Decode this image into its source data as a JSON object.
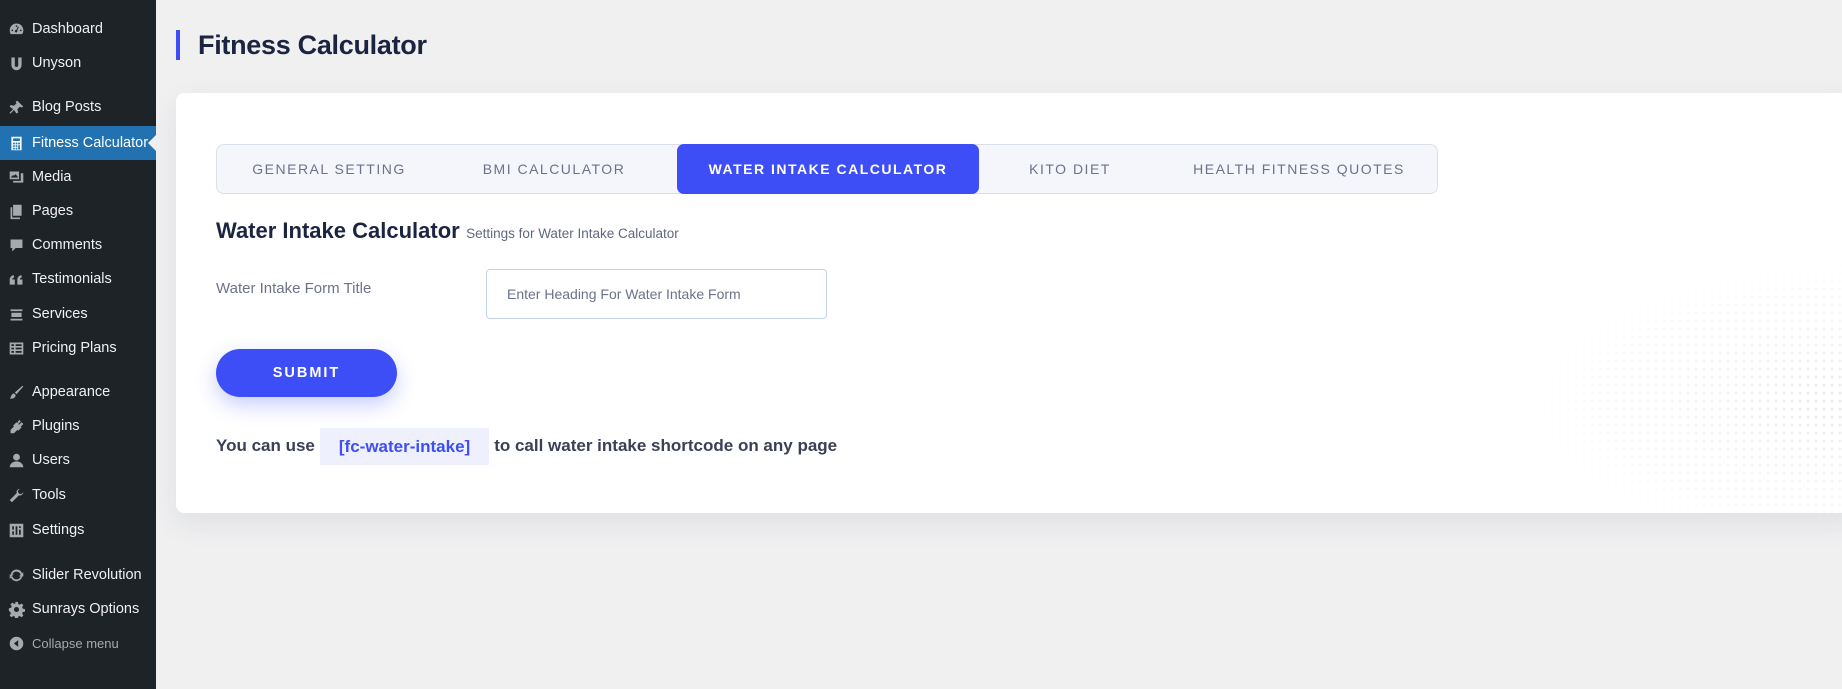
{
  "sidebar": {
    "items": [
      {
        "label": "Dashboard",
        "icon": "dashboard-icon"
      },
      {
        "label": "Unyson",
        "icon": "unyson-icon"
      },
      {
        "label": "Blog Posts",
        "icon": "pin-icon"
      },
      {
        "label": "Fitness Calculator",
        "icon": "calculator-icon",
        "active": true
      },
      {
        "label": "Media",
        "icon": "media-icon"
      },
      {
        "label": "Pages",
        "icon": "pages-icon"
      },
      {
        "label": "Comments",
        "icon": "comments-icon"
      },
      {
        "label": "Testimonials",
        "icon": "quote-icon"
      },
      {
        "label": "Services",
        "icon": "services-icon"
      },
      {
        "label": "Pricing Plans",
        "icon": "table-icon"
      },
      {
        "label": "Appearance",
        "icon": "brush-icon"
      },
      {
        "label": "Plugins",
        "icon": "plugin-icon"
      },
      {
        "label": "Users",
        "icon": "user-icon"
      },
      {
        "label": "Tools",
        "icon": "wrench-icon"
      },
      {
        "label": "Settings",
        "icon": "settings-icon"
      },
      {
        "label": "Slider Revolution",
        "icon": "revolution-icon"
      },
      {
        "label": "Sunrays Options",
        "icon": "gear-icon"
      },
      {
        "label": "Collapse menu",
        "icon": "collapse-icon"
      }
    ]
  },
  "page": {
    "title": "Fitness Calculator"
  },
  "tabs": [
    {
      "label": "GENERAL SETTING",
      "active": false
    },
    {
      "label": "BMI CALCULATOR",
      "active": false
    },
    {
      "label": "WATER INTAKE CALCULATOR",
      "active": true
    },
    {
      "label": "KITO DIET",
      "active": false
    },
    {
      "label": "HEALTH FITNESS QUOTES",
      "active": false
    }
  ],
  "section": {
    "title": "Water Intake Calculator",
    "subtitle": "Settings for Water Intake Calculator"
  },
  "form": {
    "field_label": "Water Intake Form Title",
    "field_value": "",
    "field_placeholder": "Enter Heading For Water Intake Form",
    "submit_label": "SUBMIT"
  },
  "shortcode_info": {
    "prefix": "You can use",
    "code": "[fc-water-intake]",
    "suffix": "to call water intake shortcode on any page"
  },
  "colors": {
    "accent": "#3d4ef7",
    "sidebar_bg": "#1d2327",
    "sidebar_active": "#2271b1",
    "heading": "#1b2440"
  }
}
